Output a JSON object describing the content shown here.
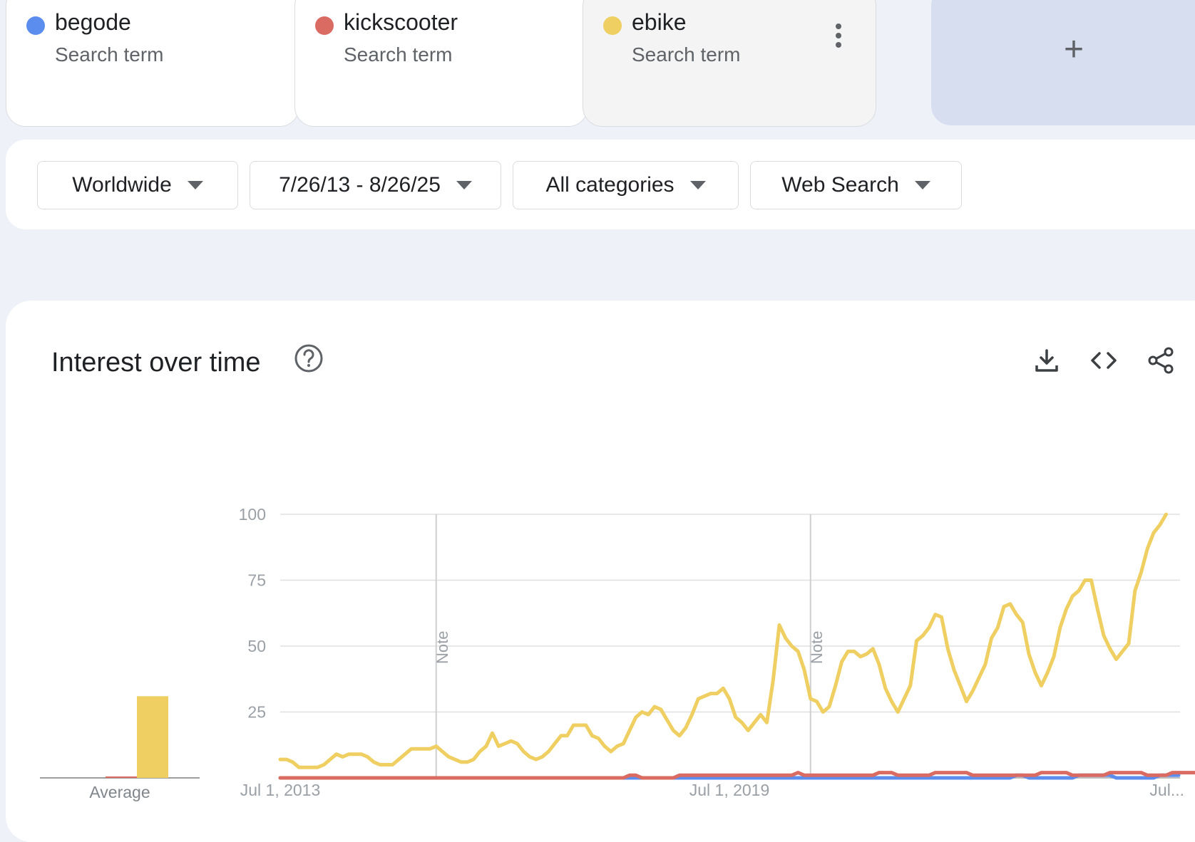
{
  "terms": [
    {
      "name": "begode",
      "subtitle": "Search term",
      "color": "#5b8def"
    },
    {
      "name": "kickscooter",
      "subtitle": "Search term",
      "color": "#d96b62"
    },
    {
      "name": "ebike",
      "subtitle": "Search term",
      "color": "#efcf62"
    }
  ],
  "add_label": "+",
  "filters": {
    "region": "Worldwide",
    "date_range": "7/26/13 - 8/26/25",
    "category": "All categories",
    "search_type": "Web Search"
  },
  "chart": {
    "title": "Interest over time",
    "icons": [
      "help-icon",
      "download-icon",
      "embed-icon",
      "share-icon"
    ],
    "grid_color": "#e0e0e0"
  },
  "chart_data": {
    "type": "line",
    "y_ticks": [
      "100",
      "75",
      "50",
      "25"
    ],
    "ylim": [
      0,
      100
    ],
    "x_ticks": [
      {
        "label": "Jul 1, 2013",
        "month": 0
      },
      {
        "label": "Jul 1, 2019",
        "month": 72
      },
      {
        "label": "Jul...",
        "month": 144
      }
    ],
    "notes": [
      {
        "label": "Note",
        "month": 25
      },
      {
        "label": "Note",
        "month": 85
      }
    ],
    "average": {
      "label": "Average",
      "values": [
        0,
        0.5,
        31
      ],
      "colors": [
        "#5b8def",
        "#d96b62",
        "#efcf62"
      ]
    },
    "series": [
      {
        "name": "begode",
        "color": "#5b8def",
        "values": [
          0,
          0,
          0,
          0,
          0,
          0,
          0,
          0,
          0,
          0,
          0,
          0,
          0,
          0,
          0,
          0,
          0,
          0,
          0,
          0,
          0,
          0,
          0,
          0,
          0,
          0,
          0,
          0,
          0,
          0,
          0,
          0,
          0,
          0,
          0,
          0,
          0,
          0,
          0,
          0,
          0,
          0,
          0,
          0,
          0,
          0,
          0,
          0,
          0,
          0,
          0,
          0,
          0,
          0,
          0,
          0,
          0,
          0,
          0,
          0,
          0,
          0,
          0,
          0,
          0,
          0,
          0,
          0,
          0,
          0,
          0,
          0,
          0,
          0,
          0,
          0,
          0,
          0,
          0,
          0,
          0,
          0,
          0,
          0,
          0,
          0,
          0,
          0,
          0,
          0,
          0,
          0,
          0,
          0,
          0,
          0,
          0,
          0,
          0,
          0,
          0,
          0,
          0,
          0,
          0,
          0,
          0,
          0,
          0,
          0,
          0,
          0,
          0,
          0,
          0,
          0,
          0,
          0,
          1,
          1,
          0,
          0,
          0,
          0,
          0,
          0,
          0,
          0,
          1,
          1,
          1,
          1,
          1,
          1,
          0,
          0,
          0,
          0,
          0,
          0,
          0,
          1,
          1,
          1,
          1
        ]
      },
      {
        "name": "kickscooter",
        "color": "#d96b62",
        "values": [
          0,
          0,
          0,
          0,
          0,
          0,
          0,
          0,
          0,
          0,
          0,
          0,
          0,
          0,
          0,
          0,
          0,
          0,
          0,
          0,
          0,
          0,
          0,
          0,
          0,
          0,
          0,
          0,
          0,
          0,
          0,
          0,
          0,
          0,
          0,
          0,
          0,
          0,
          0,
          0,
          0,
          0,
          0,
          0,
          0,
          0,
          0,
          0,
          0,
          0,
          0,
          0,
          0,
          0,
          0,
          0,
          1,
          1,
          0,
          0,
          0,
          0,
          0,
          0,
          1,
          1,
          1,
          1,
          1,
          1,
          1,
          1,
          1,
          1,
          1,
          1,
          1,
          1,
          1,
          1,
          1,
          1,
          1,
          2,
          1,
          1,
          1,
          1,
          1,
          1,
          1,
          1,
          1,
          1,
          1,
          1,
          2,
          2,
          2,
          1,
          1,
          1,
          1,
          1,
          1,
          2,
          2,
          2,
          2,
          2,
          2,
          1,
          1,
          1,
          1,
          1,
          1,
          1,
          1,
          1,
          1,
          1,
          2,
          2,
          2,
          2,
          2,
          1,
          1,
          1,
          1,
          1,
          1,
          2,
          2,
          2,
          2,
          2,
          2,
          1,
          1,
          1,
          1,
          2,
          2,
          2,
          2,
          2,
          2
        ]
      },
      {
        "name": "ebike",
        "color": "#efcf62",
        "values": [
          7,
          7,
          6,
          4,
          4,
          4,
          4,
          5,
          7,
          9,
          8,
          9,
          9,
          9,
          8,
          6,
          5,
          5,
          5,
          7,
          9,
          11,
          11,
          11,
          11,
          12,
          10,
          8,
          7,
          6,
          6,
          7,
          10,
          12,
          17,
          12,
          13,
          14,
          13,
          10,
          8,
          7,
          8,
          10,
          13,
          16,
          16,
          20,
          20,
          20,
          16,
          15,
          12,
          10,
          12,
          13,
          18,
          23,
          25,
          24,
          27,
          26,
          22,
          18,
          16,
          19,
          24,
          30,
          31,
          32,
          32,
          34,
          30,
          23,
          21,
          18,
          21,
          24,
          21,
          37,
          58,
          53,
          50,
          48,
          41,
          30,
          29,
          25,
          27,
          35,
          44,
          48,
          48,
          46,
          47,
          49,
          43,
          34,
          29,
          25,
          30,
          35,
          52,
          54,
          57,
          62,
          61,
          49,
          41,
          35,
          29,
          33,
          38,
          43,
          53,
          57,
          65,
          66,
          62,
          59,
          47,
          40,
          35,
          40,
          46,
          57,
          64,
          69,
          71,
          75,
          75,
          64,
          54,
          49,
          45,
          48,
          51,
          71,
          78,
          87,
          93,
          96,
          100
        ]
      }
    ]
  }
}
